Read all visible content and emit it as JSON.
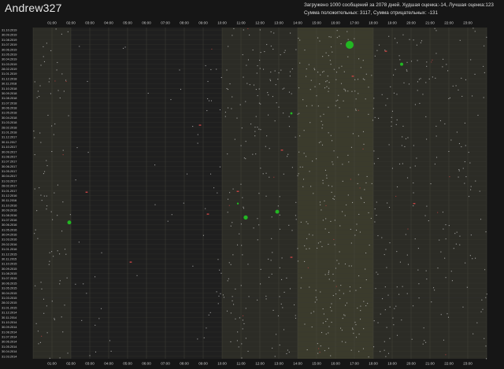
{
  "header": {
    "title": "Andrew327",
    "stats_line1": "Загружено 1000 сообщений за 2078 дней. Худшая оценка:-14, Лучшая оценка:123",
    "stats_line2": "Сумма положительных: 3117, Сумма отрицательных: -131"
  },
  "colors": {
    "background": "#161616",
    "band_day": "#3b3b2c",
    "band_mid": "#2c2c26",
    "band_night": "#1f1f1f",
    "dot_neutral": "#c9c9c9",
    "dot_negative": "#c84444",
    "dot_positive": "#22b722"
  },
  "chart_data": {
    "type": "scatter",
    "title": "",
    "xlabel": "",
    "ylabel": "",
    "hour_ticks": [
      "01:00",
      "02:00",
      "03:00",
      "04:00",
      "05:00",
      "06:00",
      "07:00",
      "08:00",
      "09:00",
      "10:00",
      "11:00",
      "12:00",
      "13:00",
      "14:00",
      "15:00",
      "16:00",
      "17:00",
      "18:00",
      "19:00",
      "20:00",
      "21:00",
      "22:00",
      "23:00"
    ],
    "date_ticks": [
      "31.10.2019",
      "30.09.2019",
      "31.08.2019",
      "31.07.2019",
      "30.06.2019",
      "31.05.2019",
      "30.04.2019",
      "31.03.2019",
      "28.02.2019",
      "31.01.2019",
      "31.12.2018",
      "30.11.2018",
      "31.10.2018",
      "30.09.2018",
      "31.08.2018",
      "31.07.2018",
      "30.06.2018",
      "31.05.2018",
      "30.04.2018",
      "31.03.2018",
      "28.02.2018",
      "31.01.2018",
      "31.12.2017",
      "30.11.2017",
      "31.10.2017",
      "30.09.2017",
      "31.08.2017",
      "31.07.2017",
      "30.06.2017",
      "31.05.2017",
      "30.04.2017",
      "31.03.2017",
      "28.02.2017",
      "31.01.2017",
      "31.12.2016",
      "30.11.2016",
      "31.10.2016",
      "30.09.2016",
      "31.08.2016",
      "31.07.2016",
      "30.06.2016",
      "31.05.2016",
      "30.04.2016",
      "31.03.2016",
      "29.02.2016",
      "31.01.2016",
      "31.12.2015",
      "30.11.2015",
      "31.10.2015",
      "30.09.2015",
      "31.08.2015",
      "31.07.2015",
      "30.06.2015",
      "31.05.2015",
      "30.04.2015",
      "31.03.2015",
      "28.02.2015",
      "31.01.2015",
      "31.12.2014",
      "30.11.2014",
      "31.10.2014",
      "30.09.2014",
      "31.08.2014",
      "31.07.2014",
      "30.06.2014",
      "31.05.2014",
      "30.04.2014",
      "31.03.2014"
    ],
    "x_range_hours": [
      0,
      24
    ],
    "band_shading": [
      "mid",
      "mid",
      "night",
      "night",
      "night",
      "night",
      "night",
      "night",
      "night",
      "night",
      "mid",
      "mid",
      "mid",
      "mid",
      "day",
      "day",
      "day",
      "day",
      "mid",
      "mid",
      "mid",
      "mid",
      "mid",
      "mid"
    ],
    "highlight_points": [
      {
        "time": "16:45",
        "date": "30.07.2019",
        "score": 123,
        "sentiment": "positive"
      },
      {
        "time": "19:30",
        "date": "31.03.2019",
        "score": 20,
        "sentiment": "positive"
      },
      {
        "time": "13:40",
        "date": "28.05.2018",
        "score": 10,
        "sentiment": "positive"
      },
      {
        "time": "01:55",
        "date": "15.07.2016",
        "score": 30,
        "sentiment": "positive"
      },
      {
        "time": "11:15",
        "date": "15.08.2016",
        "score": 35,
        "sentiment": "positive"
      },
      {
        "time": "12:55",
        "date": "20.09.2016",
        "score": 30,
        "sentiment": "positive"
      },
      {
        "time": "10:50",
        "date": "10.11.2016",
        "score": 5,
        "sentiment": "positive"
      },
      {
        "time": "18:40",
        "date": "20.06.2019",
        "score": -10,
        "sentiment": "negative"
      },
      {
        "time": "16:55",
        "date": "15.01.2019",
        "score": -14,
        "sentiment": "negative"
      },
      {
        "time": "08:50",
        "date": "15.03.2018",
        "score": -5,
        "sentiment": "negative"
      },
      {
        "time": "13:10",
        "date": "10.10.2017",
        "score": -4,
        "sentiment": "negative"
      },
      {
        "time": "02:50",
        "date": "20.01.2017",
        "score": -3,
        "sentiment": "negative"
      },
      {
        "time": "20:10",
        "date": "10.11.2016",
        "score": -5,
        "sentiment": "negative"
      },
      {
        "time": "05:10",
        "date": "10.11.2015",
        "score": -3,
        "sentiment": "negative"
      },
      {
        "time": "13:40",
        "date": "10.12.2015",
        "score": -4,
        "sentiment": "negative"
      },
      {
        "time": "10:50",
        "date": "25.01.2017",
        "score": -2,
        "sentiment": "negative"
      },
      {
        "time": "09:15",
        "date": "05.09.2016",
        "score": -2,
        "sentiment": "negative"
      }
    ]
  }
}
